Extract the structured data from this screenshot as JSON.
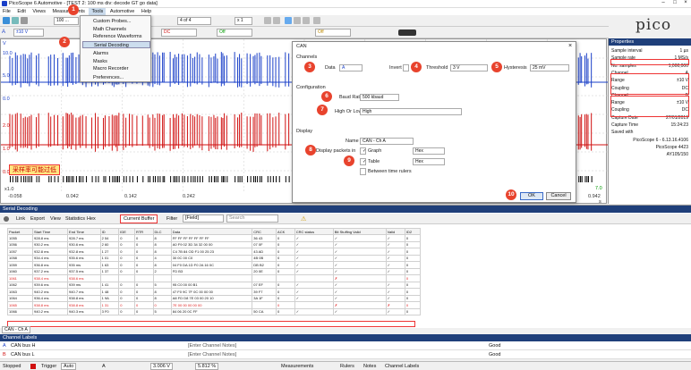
{
  "window": {
    "title": "PicoScope 6 Automotive - [TEST 2: 100 ms div: decode GT go data]"
  },
  "menubar": [
    "File",
    "Edit",
    "Views",
    "Measurements",
    "Tools",
    "Automotive",
    "Help"
  ],
  "toolbar1": {
    "zoom": "100 ...",
    "buffer": "4 of 4",
    "zoom_factor": "x 1"
  },
  "toolbar2": {
    "ch_a_range": "±10 V",
    "ch_a_coupling": "DC",
    "ch_b_coupling": "DC",
    "trigger": "Off",
    "trig2": "Off"
  },
  "tools_menu": {
    "items": [
      "Custom Probes...",
      "Math Channels",
      "Reference Waveforms",
      "Serial Decoding",
      "Alarms",
      "Masks",
      "Macro Recorder",
      "Preferences..."
    ]
  },
  "logo": "pico",
  "scope": {
    "y_labels_a": [
      "10.0",
      "5.0",
      "0.0"
    ],
    "y_labels_b": [
      "3.0",
      "2.0",
      "1.0",
      "0.0"
    ],
    "y_left": [
      "V",
      "A"
    ],
    "x_labels": [
      "-0.058",
      "0.042",
      "0.142",
      "0.242",
      "0.942"
    ],
    "x_unit": "s",
    "right_labels": [
      "7.0",
      "x1.0"
    ],
    "warning": "采样率可能过低",
    "ch_a_label": "A",
    "ch_b_label": "B"
  },
  "properties": {
    "title": "Properties",
    "rows": [
      {
        "label": "Sample interval",
        "value": "1 µs"
      },
      {
        "label": "Sample rate",
        "value": "1 MS/s"
      },
      {
        "label": "No. samples",
        "value": "1,000,000"
      },
      {
        "label": "Channel",
        "value": "A"
      },
      {
        "label": "Range",
        "value": "±10 V"
      },
      {
        "label": "Coupling",
        "value": "DC"
      },
      {
        "label": "Channel",
        "value": "B"
      },
      {
        "label": "Range",
        "value": "±10 V"
      },
      {
        "label": "Coupling",
        "value": "DC"
      },
      {
        "label": "Capture Date",
        "value": "27/01/2019"
      },
      {
        "label": "Capture Time",
        "value": "15:24:23"
      },
      {
        "label": "Saved with",
        "value": ""
      },
      {
        "label": "",
        "value": "PicoScope 6 - 6.13.16.4106"
      },
      {
        "label": "",
        "value": "PicoScope 4423"
      },
      {
        "label": "",
        "value": "AY105/150"
      }
    ]
  },
  "dialog": {
    "title": "CAN",
    "channels_label": "Channels",
    "data_label": "Data",
    "data_value": "A",
    "invert_label": "Invert",
    "threshold_label": "Threshold",
    "threshold_value": "3 V",
    "hysteresis_label": "Hysteresis",
    "hysteresis_value": "25 mV",
    "config_label": "Configuration",
    "baud_label": "Baud Rate",
    "baud_value": "500 kbaud",
    "hilo_label": "High Or Low",
    "hilo_value": "High",
    "display_label": "Display",
    "name_label": "Name",
    "name_value": "CAN - Ch A",
    "packets_label": "Display packets in",
    "graph_label": "Graph",
    "graph_fmt": "Hex",
    "table_label": "Table",
    "table_fmt": "Hex",
    "between_label": "Between time rulers",
    "ok": "OK",
    "cancel": "Cancel"
  },
  "badges": [
    "1",
    "2",
    "3",
    "4",
    "5",
    "6",
    "7",
    "8",
    "9",
    "10"
  ],
  "decoding": {
    "title": "Serial Decoding",
    "toolbar": {
      "link": "Link",
      "export": "Export",
      "view": "View",
      "statistics": "Statistics",
      "hex": "Hex",
      "buffer": "Current Buffer",
      "filter": "Filter",
      "field": "[Field]",
      "search": "Search"
    },
    "columns": [
      "Packet",
      "Start Time",
      "End Time",
      "ID",
      "IDE",
      "RTR",
      "DLC",
      "Data",
      "CRC",
      "ACK",
      "CRC status",
      "Bit Stuffing Valid",
      "Valid",
      "ID2"
    ],
    "rows": [
      [
        "1055",
        "928.8 ms",
        "928.7 ms",
        "2 54",
        "0",
        "0",
        "8",
        "FF FF FF FF FF FF FF",
        "36 43",
        "0",
        "✓",
        "✓",
        "✓",
        "0"
      ],
      [
        "1056",
        "930.2 ms",
        "930.6 ms",
        "2 60",
        "0",
        "0",
        "8",
        "A0 F9 02 3D 34 32 00 00",
        "07 0F",
        "0",
        "✓",
        "✓",
        "✓",
        "0"
      ],
      [
        "1057",
        "932.8 ms",
        "932.8 ms",
        "1 27",
        "0",
        "0",
        "8",
        "C4 7B 84 OD F1 00 25 23",
        "43 AD",
        "0",
        "✓",
        "✓",
        "✓",
        "0"
      ],
      [
        "1058",
        "934.4 ms",
        "935.6 ms",
        "1 01",
        "0",
        "0",
        "4",
        "30 0C 00 C0",
        "4B 0B",
        "0",
        "✓",
        "✓",
        "✓",
        "0"
      ],
      [
        "1059",
        "936.8 ms",
        "935 ms",
        "1 63",
        "0",
        "0",
        "8",
        "04 F0 DA 1D F0 2A 16 0C",
        "DB B2",
        "0",
        "✓",
        "✓",
        "✓",
        "0"
      ],
      [
        "1060",
        "937.2 ms",
        "937.5 ms",
        "1 37",
        "0",
        "0",
        "2",
        "FD B3",
        "20 0E",
        "0",
        "✓",
        "✓",
        "✓",
        "0"
      ],
      [
        "1061",
        "938.4 ms",
        "938.6 ms",
        "",
        "",
        "",
        "",
        "",
        "",
        "",
        "",
        "✗",
        "",
        "0"
      ],
      [
        "1062",
        "939.6 ms",
        "939 ms",
        "1 41",
        "0",
        "0",
        "5",
        "95 C0 00 00 B1",
        "07 EF",
        "0",
        "✓",
        "✓",
        "✓",
        "0"
      ],
      [
        "1063",
        "940.2 ms",
        "940.7 ms",
        "1 48",
        "0",
        "0",
        "8",
        "47 F0 9C 7F 0C 00 00 00",
        "39 F7",
        "0",
        "✓",
        "✓",
        "✓",
        "0"
      ],
      [
        "1064",
        "936.4 ms",
        "938.8 ms",
        "1 9A",
        "0",
        "0",
        "8",
        "A8 FD D8 7E 03 00 20 10",
        "3A 1F",
        "0",
        "✓",
        "✓",
        "✓",
        "0"
      ],
      [
        "1065",
        "938.8 ms",
        "938.8 ms",
        "1 31",
        "0",
        "0",
        "0",
        "7E 00 00 00 00 00",
        "",
        "0",
        "",
        "✗",
        "✗",
        "0"
      ],
      [
        "1066",
        "940.2 ms",
        "940.3 ms",
        "3 F0",
        "0",
        "0",
        "5",
        "84 06 20 0C FF",
        "50 CA",
        "0",
        "✓",
        "✓",
        "✓",
        "0"
      ]
    ],
    "tab": "CAN - Ch A"
  },
  "channel_labels": {
    "title": "Channel Labels",
    "rows": [
      {
        "ch": "A",
        "name": "CAN bus H",
        "notes": "[Enter Channel Notes]",
        "status": "Good"
      },
      {
        "ch": "B",
        "name": "CAN bus L",
        "notes": "[Enter Channel Notes]",
        "status": "Good"
      }
    ]
  },
  "statusbar": {
    "stopped": "Stopped",
    "trigger": "Trigger",
    "trig_mode": "Auto",
    "ch": "A",
    "level": "3.006 V",
    "pretrig": "5.812 %",
    "measurements": "Measurements",
    "rulers": "Rulers",
    "notes": "Notes",
    "channel_labels": "Channel Labels"
  },
  "colors": {
    "accent": "#1f3f7a",
    "ch_a": "#1a3fc8",
    "ch_b": "#d01010",
    "badge": "#e8432d"
  }
}
